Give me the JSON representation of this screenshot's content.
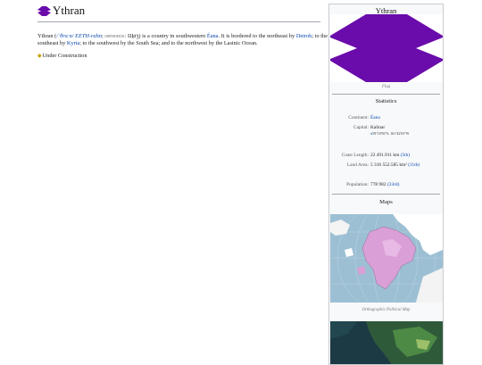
{
  "page": {
    "title": "Ythran"
  },
  "lead": {
    "name": "Ythran",
    "paren_open": " (",
    "ipa": "/ˈθrɑːn/",
    "respell": "EETH-rahn",
    "sep": "; ",
    "sc_label": "orthodox:",
    "native": " Щɑ̈ʒ",
    "body1": ") is a country in southwestern ",
    "link_eana": "Éana",
    "body2": ". It is bordered to the northeast by ",
    "link_deiroh": "Deiroh",
    "body3": "; to the southeast by ",
    "link_kyria": "Kyria",
    "body4": "; to the southwest by the South Sea; and to the northwest by the Lasinic Ocean."
  },
  "notice": {
    "icon": "construction-dot-icon",
    "text": "Under Construction"
  },
  "infobox": {
    "title": "Ythran",
    "flag_caption": "Flag",
    "flag_color": "#6a0bab",
    "statistics_heading": "Statistics",
    "continent_label": "Continent:",
    "continent_value": "Éana",
    "capital_label": "Capital:",
    "capital_value": "Kalinar",
    "capital_coords": "59°18′56″S, 161°42′03″W",
    "coast_label": "Coast Length:",
    "coast_value": "22 491.911 km",
    "coast_rank": "(5th)",
    "area_label": "Land Area:",
    "area_value": "5 316 552.585 km²",
    "area_rank": "(11th)",
    "population_label": "Population:",
    "population_value": "778 982",
    "population_rank": "(33rd)",
    "maps_heading": "Maps",
    "map1_caption": "Orthographic Political Map"
  }
}
